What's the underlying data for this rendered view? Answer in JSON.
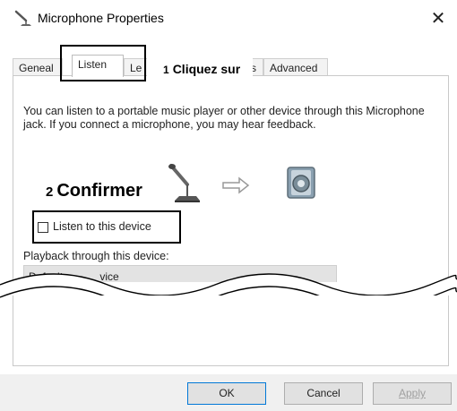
{
  "window": {
    "title": "Microphone Properties",
    "close_glyph": "✕"
  },
  "tabs": [
    {
      "label": "Gene",
      "suffix": "al",
      "active": false
    },
    {
      "label": "Listen",
      "active": true
    },
    {
      "label": "Le",
      "active": false
    },
    {
      "label": "s",
      "active": false
    },
    {
      "label": "Advanced",
      "active": false
    }
  ],
  "annotations": {
    "step1_number": "1",
    "step1_text": "Cliquez sur",
    "step2_number": "2",
    "step2_text": "Confirmer"
  },
  "listen": {
    "description": "You can listen to a portable music player or other device through this Microphone jack.  If you connect a microphone, you may hear feedback.",
    "checkbox_label": "Listen to this device",
    "checkbox_checked": false,
    "playback_label": "Playback through this device:",
    "playback_value": "Default ",
    "playback_value_tail": "vice"
  },
  "buttons": {
    "ok": "OK",
    "cancel": "Cancel",
    "apply": "Apply"
  },
  "icons": {
    "title": "microphone-icon",
    "close": "close-icon",
    "mic": "microphone-icon",
    "arrow": "arrow-right-icon",
    "speaker": "speaker-icon"
  },
  "colors": {
    "ok_border": "#0078d7",
    "footer_bg": "#f0f0f0",
    "disabled_text": "#a0a0a0"
  }
}
